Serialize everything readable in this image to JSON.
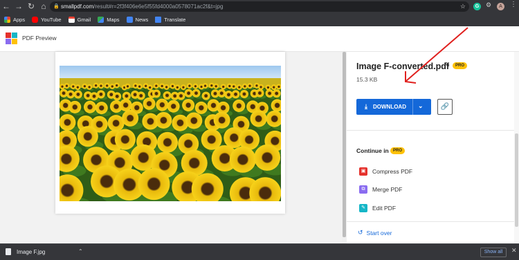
{
  "browser": {
    "url_host": "smallpdf.com",
    "url_path": "/result#r=2f3f406e6e5f55fd4000a0578071ac2f&t=jpg",
    "bookmarks": [
      {
        "label": "Apps",
        "icon": "apps-grid-icon"
      },
      {
        "label": "YouTube",
        "icon": "youtube-icon"
      },
      {
        "label": "Gmail",
        "icon": "gmail-icon"
      },
      {
        "label": "Maps",
        "icon": "maps-icon"
      },
      {
        "label": "News",
        "icon": "news-icon"
      },
      {
        "label": "Translate",
        "icon": "translate-icon"
      }
    ],
    "profile_initial": "A"
  },
  "app": {
    "title": "PDF Preview"
  },
  "file": {
    "name": "Image F-converted.pdf",
    "size": "15.3 KB",
    "pro_badge": "PRO"
  },
  "actions": {
    "download_label": "DOWNLOAD"
  },
  "continue": {
    "heading": "Continue in",
    "pro_badge": "PRO",
    "tools": [
      {
        "label": "Compress PDF",
        "color": "#e5322d"
      },
      {
        "label": "Merge PDF",
        "color": "#8a6cf0"
      },
      {
        "label": "Edit PDF",
        "color": "#15b6c7"
      }
    ],
    "start_over": "Start over"
  },
  "download_bar": {
    "file_name": "Image F.jpg",
    "show_all": "Show all"
  },
  "colors": {
    "accent": "#1468d9",
    "pro": "#ffc107",
    "annotation_arrow": "#e0201e"
  }
}
